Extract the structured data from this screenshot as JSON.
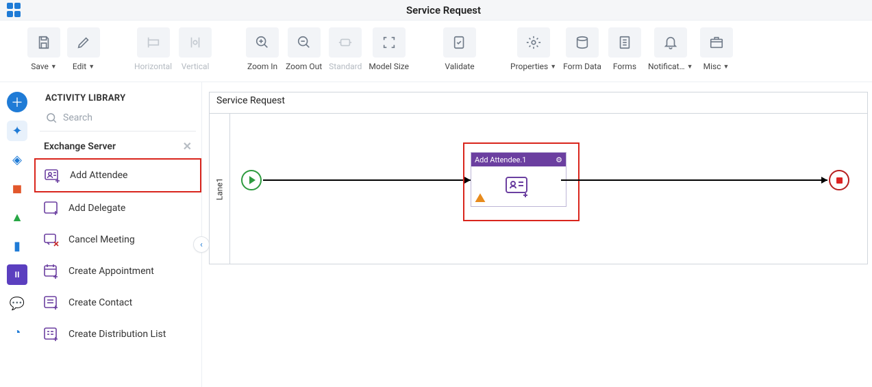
{
  "title": "Service Request",
  "toolbar": [
    {
      "label": "Save",
      "chev": true,
      "disabled": false
    },
    {
      "label": "Edit",
      "chev": true,
      "disabled": false
    },
    {
      "label": "Horizontal",
      "chev": false,
      "disabled": true
    },
    {
      "label": "Vertical",
      "chev": false,
      "disabled": true
    },
    {
      "label": "Zoom In",
      "chev": false,
      "disabled": false
    },
    {
      "label": "Zoom Out",
      "chev": false,
      "disabled": false
    },
    {
      "label": "Standard",
      "chev": false,
      "disabled": true
    },
    {
      "label": "Model Size",
      "chev": false,
      "disabled": false
    },
    {
      "label": "Validate",
      "chev": false,
      "disabled": false
    },
    {
      "label": "Properties",
      "chev": true,
      "disabled": false
    },
    {
      "label": "Form Data",
      "chev": false,
      "disabled": false
    },
    {
      "label": "Forms",
      "chev": false,
      "disabled": false
    },
    {
      "label": "Notificat…",
      "chev": true,
      "disabled": false
    },
    {
      "label": "Misc",
      "chev": true,
      "disabled": false
    }
  ],
  "sidebar": {
    "title": "ACTIVITY LIBRARY",
    "search_placeholder": "Search",
    "category": "Exchange Server",
    "items": [
      {
        "label": "Add Attendee",
        "hl": true
      },
      {
        "label": "Add Delegate",
        "hl": false
      },
      {
        "label": "Cancel Meeting",
        "hl": false
      },
      {
        "label": "Create Appointment",
        "hl": false
      },
      {
        "label": "Create Contact",
        "hl": false
      },
      {
        "label": "Create Distribution List",
        "hl": false
      }
    ]
  },
  "canvas": {
    "title": "Service Request",
    "lane": "Lane1",
    "activity_title": "Add Attendee.1"
  }
}
